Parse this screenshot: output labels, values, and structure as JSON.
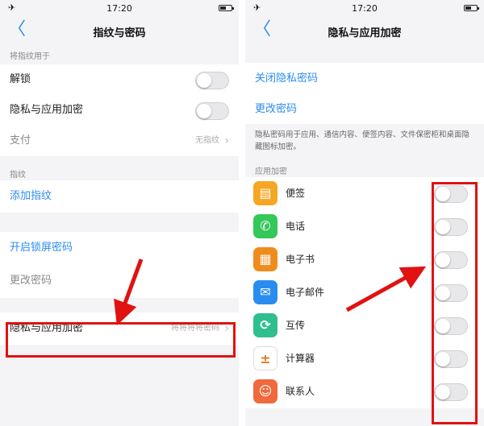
{
  "left": {
    "status": {
      "time": "17:20"
    },
    "nav": {
      "back": "〈",
      "title": "指纹与密码"
    },
    "section_use": "将指纹用于",
    "rows_use": [
      {
        "label": "解锁"
      },
      {
        "label": "隐私与应用加密"
      },
      {
        "label": "支付",
        "hint": "无指纹"
      }
    ],
    "section_fp": "指纹",
    "add_fp": "添加指纹",
    "enable_lock_pw": "开启锁屏密码",
    "change_pw": "更改密码",
    "privacy_row": {
      "label": "隐私与应用加密",
      "hint": "将将将将密码"
    }
  },
  "right": {
    "status": {
      "time": "17:20"
    },
    "nav": {
      "back": "〈",
      "title": "隐私与应用加密"
    },
    "close_privacy_pw": "关闭隐私密码",
    "change_pw": "更改密码",
    "desc": "隐私密码用于应用、通信内容、便签内容、文件保密柜和桌面隐藏图标加密。",
    "section_app": "应用加密",
    "apps": [
      {
        "name": "便签",
        "icon": "notes-icon",
        "color": "#f5a623",
        "glyph": "▤"
      },
      {
        "name": "电话",
        "icon": "phone-icon",
        "color": "#34c759",
        "glyph": "✆"
      },
      {
        "name": "电子书",
        "icon": "ebook-icon",
        "color": "#f08c1e",
        "glyph": "▦"
      },
      {
        "name": "电子邮件",
        "icon": "mail-icon",
        "color": "#2b8cf0",
        "glyph": "✉"
      },
      {
        "name": "互传",
        "icon": "transfer-icon",
        "color": "#2fbf8f",
        "glyph": "⟳"
      },
      {
        "name": "计算器",
        "icon": "calculator-icon",
        "color": "#ffffff",
        "glyph": "±"
      },
      {
        "name": "联系人",
        "icon": "contacts-icon",
        "color": "#f06a3c",
        "glyph": "☺"
      }
    ]
  },
  "colors": {
    "accent_blue": "#2b8cf0",
    "highlight_red": "#e01212"
  }
}
